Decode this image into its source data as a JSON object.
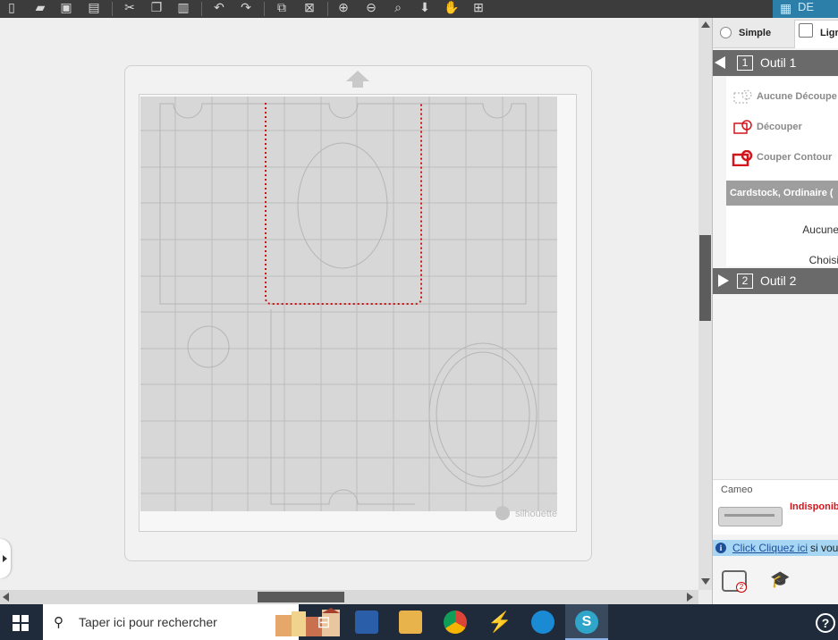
{
  "panel": {
    "tabs": [
      {
        "label": "Simple"
      },
      {
        "label": "Ligr"
      }
    ],
    "design_tab_label": "DE",
    "tool1": {
      "number": "1",
      "label": "Outil 1"
    },
    "tool2": {
      "number": "2",
      "label": "Outil 2"
    },
    "cut_options": [
      {
        "label": "Aucune Découpe"
      },
      {
        "label": "Découper"
      },
      {
        "label": "Couper Contour"
      }
    ],
    "material": {
      "header": "Cardstock, Ordinaire (",
      "line1": "Aucune",
      "line2": "Choisi"
    },
    "device": {
      "name": "Cameo",
      "status": "Indisponib"
    },
    "info": {
      "link": "Click Cliquez ici",
      "text": "si vou"
    }
  },
  "taskbar": {
    "search_placeholder": "Taper ici pour rechercher"
  },
  "mat": {
    "brand": "silhouette"
  },
  "colors": {
    "accent": "#2b7fa8",
    "cut_line": "#d4141b",
    "info_bg": "#a7d6f4"
  }
}
